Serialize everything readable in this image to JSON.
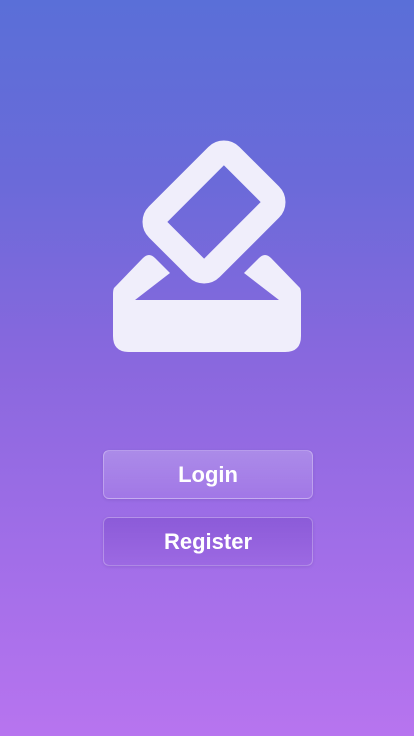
{
  "app": {
    "logo_icon": "inbox-upload-icon",
    "logo_color": "#f0eefb"
  },
  "buttons": {
    "login_label": "Login",
    "register_label": "Register"
  },
  "colors": {
    "gradient_top": "#5a6fd8",
    "gradient_bottom": "#b774ef",
    "button_text": "#ffffff"
  }
}
